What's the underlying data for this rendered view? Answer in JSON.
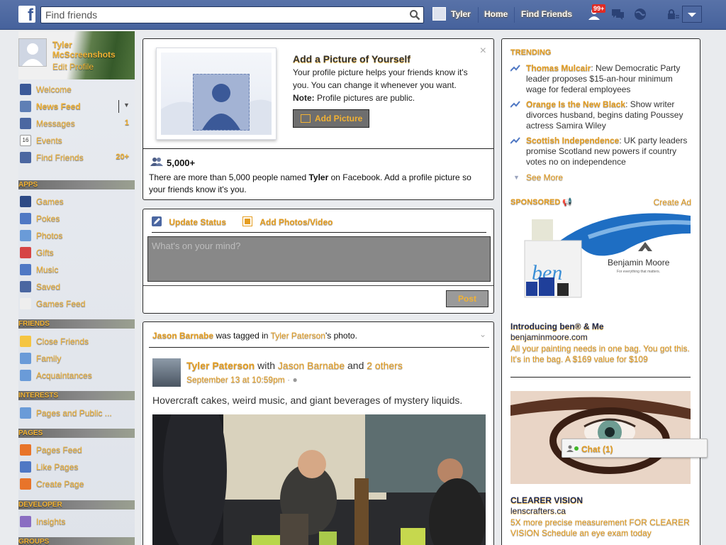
{
  "topbar": {
    "search_placeholder": "Find friends",
    "user_name": "Tyler",
    "home": "Home",
    "find_friends": "Find Friends",
    "notif_count": "99+",
    "brand_color": "#3b5998"
  },
  "sidebar": {
    "profile_name": "Tyler McScreenshots",
    "edit_profile": "Edit Profile",
    "items": [
      {
        "label": "Welcome",
        "icon": "facebook-icon"
      },
      {
        "label": "News Feed",
        "icon": "news-feed-icon"
      },
      {
        "label": "Messages",
        "icon": "messages-icon",
        "count": "1"
      },
      {
        "label": "Events",
        "icon": "calendar-icon",
        "date": "16"
      },
      {
        "label": "Find Friends",
        "icon": "find-friends-icon",
        "count": "20+"
      }
    ],
    "apps_header": "APPS",
    "apps": [
      {
        "label": "Games",
        "icon": "games-icon"
      },
      {
        "label": "Pokes",
        "icon": "pokes-icon"
      },
      {
        "label": "Photos",
        "icon": "photos-icon"
      },
      {
        "label": "Gifts",
        "icon": "gift-icon"
      },
      {
        "label": "Music",
        "icon": "music-icon"
      },
      {
        "label": "Saved",
        "icon": "saved-icon"
      },
      {
        "label": "Games Feed",
        "icon": "games-feed-icon"
      }
    ],
    "friends_header": "FRIENDS",
    "friends": [
      {
        "label": "Close Friends",
        "icon": "star-icon"
      },
      {
        "label": "Family",
        "icon": "family-icon"
      },
      {
        "label": "Acquaintances",
        "icon": "acquaintances-icon"
      }
    ],
    "interests_header": "INTERESTS",
    "interests": [
      {
        "label": "Pages and Public ...",
        "icon": "rss-icon"
      }
    ],
    "pages_header": "PAGES",
    "pages": [
      {
        "label": "Pages Feed",
        "icon": "megaphone-icon"
      },
      {
        "label": "Like Pages",
        "icon": "thumbs-up-icon"
      },
      {
        "label": "Create Page",
        "icon": "plus-icon"
      }
    ],
    "developer_header": "DEVELOPER",
    "developer": [
      {
        "label": "Insights",
        "icon": "insights-icon"
      }
    ],
    "groups_header": "GROUPS"
  },
  "profile_prompt": {
    "title": "Add a Picture of Yourself",
    "desc": "Your profile picture helps your friends know it's you. You can change it whenever you want.",
    "note_label": "Note:",
    "note_text": " Profile pictures are public.",
    "button": "Add Picture",
    "close": "×",
    "people_count": "5,000+",
    "people_text_pre": "There are more than 5,000 people named ",
    "people_name": "Tyler",
    "people_text_post": " on Facebook. Add a profile picture so your friends know it's you."
  },
  "composer": {
    "tab_status": "Update Status",
    "tab_photos": "Add Photos/Video",
    "placeholder": "What's on your mind?",
    "post_button": "Post"
  },
  "feed": {
    "tagged_name": "Jason Barnabe",
    "tagged_mid": " was tagged in ",
    "tagged_owner": "Tyler Paterson",
    "tagged_end": "'s photo.",
    "author": "Tyler Paterson",
    "with": " with ",
    "with_name": "Jason Barnabe",
    "and": " and ",
    "others": "2 others",
    "time": "September 13 at 10:59pm",
    "text": "Hovercraft cakes, weird music, and giant beverages of mystery liquids."
  },
  "trending": {
    "title": "TRENDING",
    "items": [
      {
        "topic": "Thomas Mulcair",
        "text": ": New Democratic Party leader proposes $15-an-hour minimum wage for federal employees"
      },
      {
        "topic": "Orange Is the New Black",
        "text": ": Show writer divorces husband, begins dating Poussey actress Samira Wiley"
      },
      {
        "topic": "Scottish Independence",
        "text": ": UK party leaders promise Scotland new powers if country votes no on independence"
      }
    ],
    "see_more": "See More"
  },
  "sponsored": {
    "title": "SPONSORED",
    "create_ad": "Create Ad",
    "ads": [
      {
        "title": "Introducing ben® & Me",
        "url": "benjaminmoore.com",
        "desc": "All your painting needs in one bag. You got this. It's in the bag. A $169 value for $109",
        "brand": "Benjamin Moore",
        "tagline": "For everything that matters.",
        "logo_text": "ben"
      },
      {
        "title": "CLEARER VISION",
        "url": "lenscrafters.ca",
        "desc": "5X more precise measurement FOR CLEARER VISION Schedule an eye exam today"
      }
    ]
  },
  "chat": {
    "label": "Chat (1)"
  }
}
